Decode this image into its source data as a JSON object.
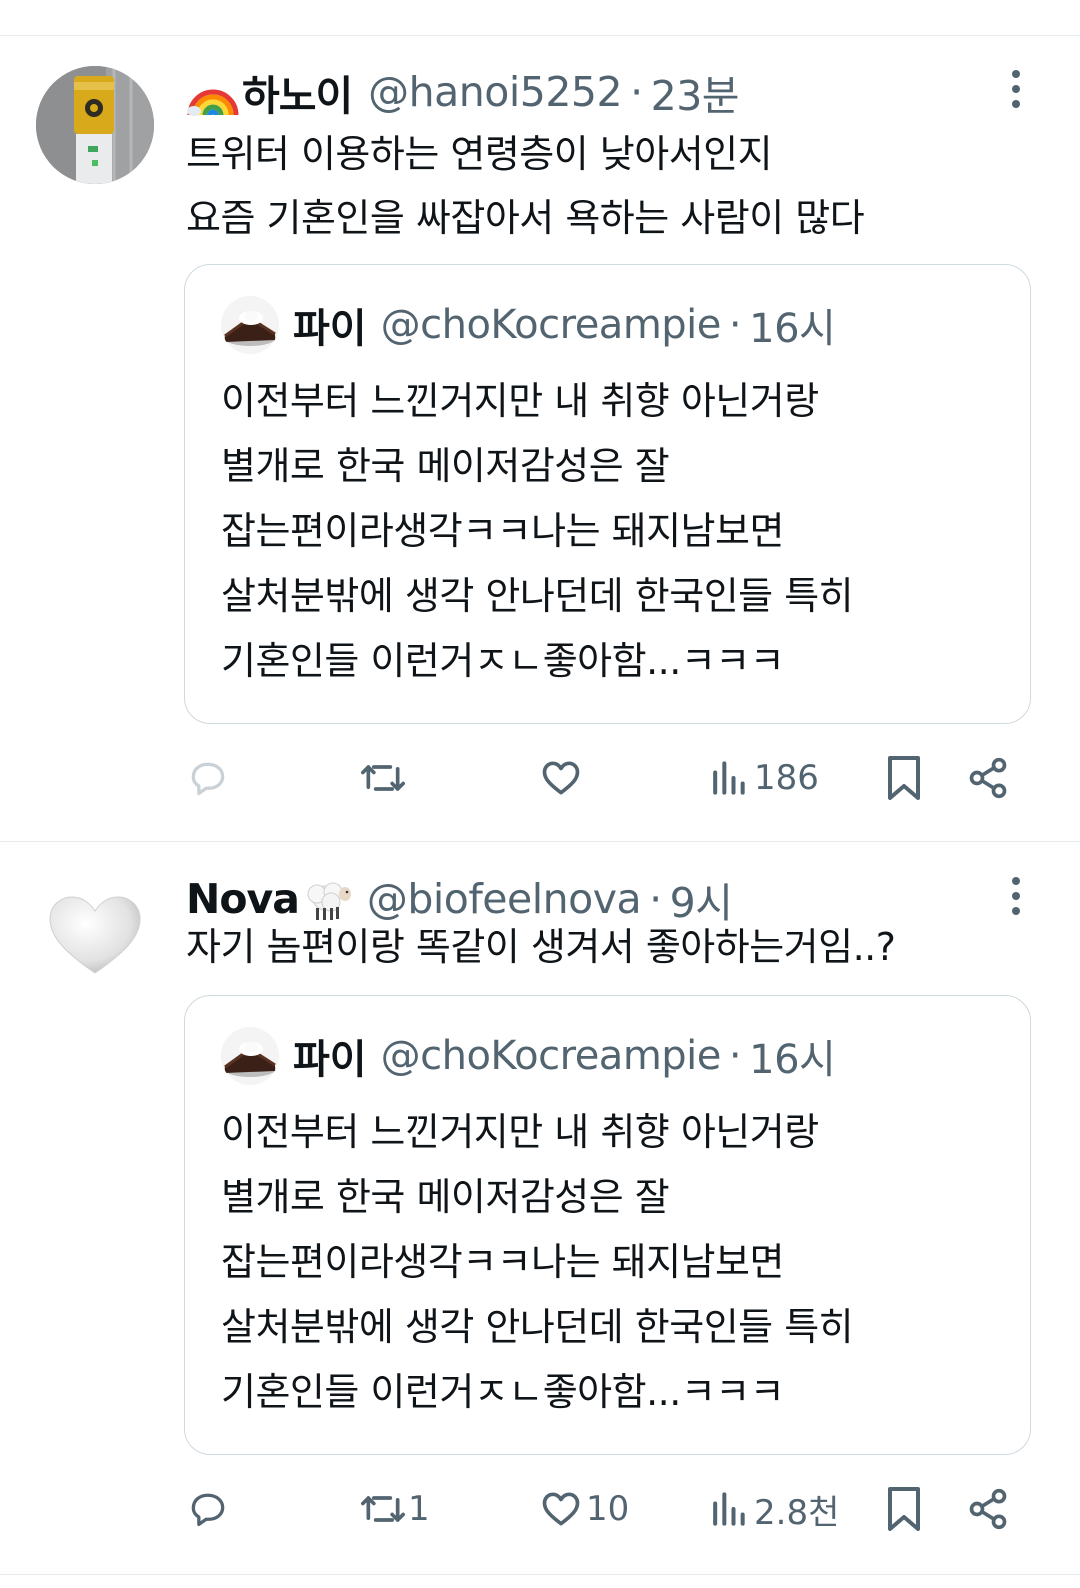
{
  "tweets": [
    {
      "name": "하노이",
      "name_emoji": "rainbow-emoji",
      "handle": "@hanoi5252",
      "separator": "·",
      "time": "23분",
      "text": "트위터 이용하는 연령층이 낮아서인지\n요즘 기혼인을 싸잡아서 욕하는 사람이 많다",
      "avatar": "water-dispenser-photo",
      "quote": {
        "name": "파이",
        "handle": "@choKocreampie",
        "separator": "·",
        "time": "16시",
        "text": "이전부터 느낀거지만 내 취향 아닌거랑\n별개로 한국 메이저감성은 잘\n잡는편이라생각ㅋㅋ나는 돼지남보면\n살처분밖에 생각 안나던데 한국인들 특히\n기혼인들 이런거ㅈㄴ좋아함...ㅋㅋㅋ"
      },
      "actions": {
        "reply": "",
        "retweet": "",
        "like": "",
        "views": "186"
      }
    },
    {
      "name": "Nova",
      "name_emoji": "sheep-emoji",
      "handle": "@biofeelnova",
      "separator": "·",
      "time": "9시",
      "text": "자기 놈편이랑 똑같이 생겨서 좋아하는거임..?",
      "avatar": "white-heart",
      "quote": {
        "name": "파이",
        "handle": "@choKocreampie",
        "separator": "·",
        "time": "16시",
        "text": "이전부터 느낀거지만 내 취향 아닌거랑\n별개로 한국 메이저감성은 잘\n잡는편이라생각ㅋㅋ나는 돼지남보면\n살처분밖에 생각 안나던데 한국인들 특히\n기혼인들 이런거ㅈㄴ좋아함...ㅋㅋㅋ"
      },
      "actions": {
        "reply": "",
        "retweet": "1",
        "like": "10",
        "views": "2.8천"
      }
    }
  ],
  "colors": {
    "text": "#0f1419",
    "secondary": "#536471",
    "border": "#cfd9de",
    "divider": "#e7e9eb"
  },
  "icons": [
    "reply-icon",
    "retweet-icon",
    "like-icon",
    "views-icon",
    "bookmark-icon",
    "share-icon",
    "more-icon"
  ]
}
